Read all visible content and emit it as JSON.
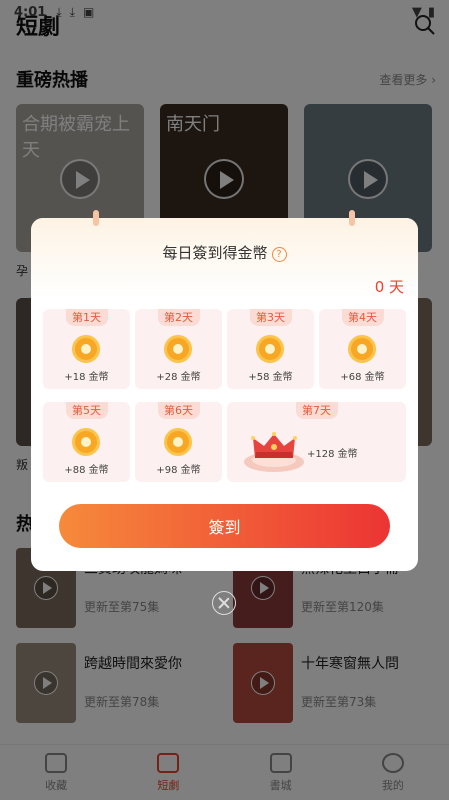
{
  "status_bar": {
    "time": "4:01",
    "icons": [
      "download-icon",
      "download-icon",
      "a-icon"
    ]
  },
  "header": {
    "title": "短劇"
  },
  "featured": {
    "title": "重磅热播",
    "more": "查看更多"
  },
  "featured_posters": [
    {
      "text": "合期被霸宠上天",
      "color": "#a9a6a0"
    },
    {
      "text": "南天门",
      "color": "#3a2b20"
    },
    {
      "text": "",
      "color": "#6c7a83"
    }
  ],
  "poster_captions": {
    "first": "孕"
  },
  "row2_captions": {
    "first": "叛"
  },
  "section2": {
    "title_initial": "热"
  },
  "list": [
    {
      "title": "三寶助攻龍媽咪",
      "sub": "更新至第75集"
    },
    {
      "title": "熱辣花王白子冊",
      "sub": "更新至第120集"
    },
    {
      "title": "跨越時間來愛你",
      "sub": "更新至第78集"
    },
    {
      "title": "十年寒窗無人問",
      "sub": "更新至第73集"
    }
  ],
  "bottom_nav": [
    {
      "label": "收藏",
      "icon": "bookmark-icon"
    },
    {
      "label": "短劇",
      "icon": "play-icon"
    },
    {
      "label": "書城",
      "icon": "book-icon"
    },
    {
      "label": "我的",
      "icon": "user-icon"
    }
  ],
  "dialog": {
    "title": "每日簽到得金幣",
    "days": "0 天",
    "button": "簽到",
    "days_list": [
      {
        "day": "第1天",
        "reward": "+18 金幣"
      },
      {
        "day": "第2天",
        "reward": "+28 金幣"
      },
      {
        "day": "第3天",
        "reward": "+58 金幣"
      },
      {
        "day": "第4天",
        "reward": "+68 金幣"
      },
      {
        "day": "第5天",
        "reward": "+88 金幣"
      },
      {
        "day": "第6天",
        "reward": "+98 金幣"
      },
      {
        "day": "第7天",
        "reward": "+128 金幣"
      }
    ]
  },
  "colors": {
    "accent": "#e8442e",
    "button_start": "#f68a3b",
    "button_end": "#ec3434",
    "card_bg": "#fdf0f0"
  }
}
